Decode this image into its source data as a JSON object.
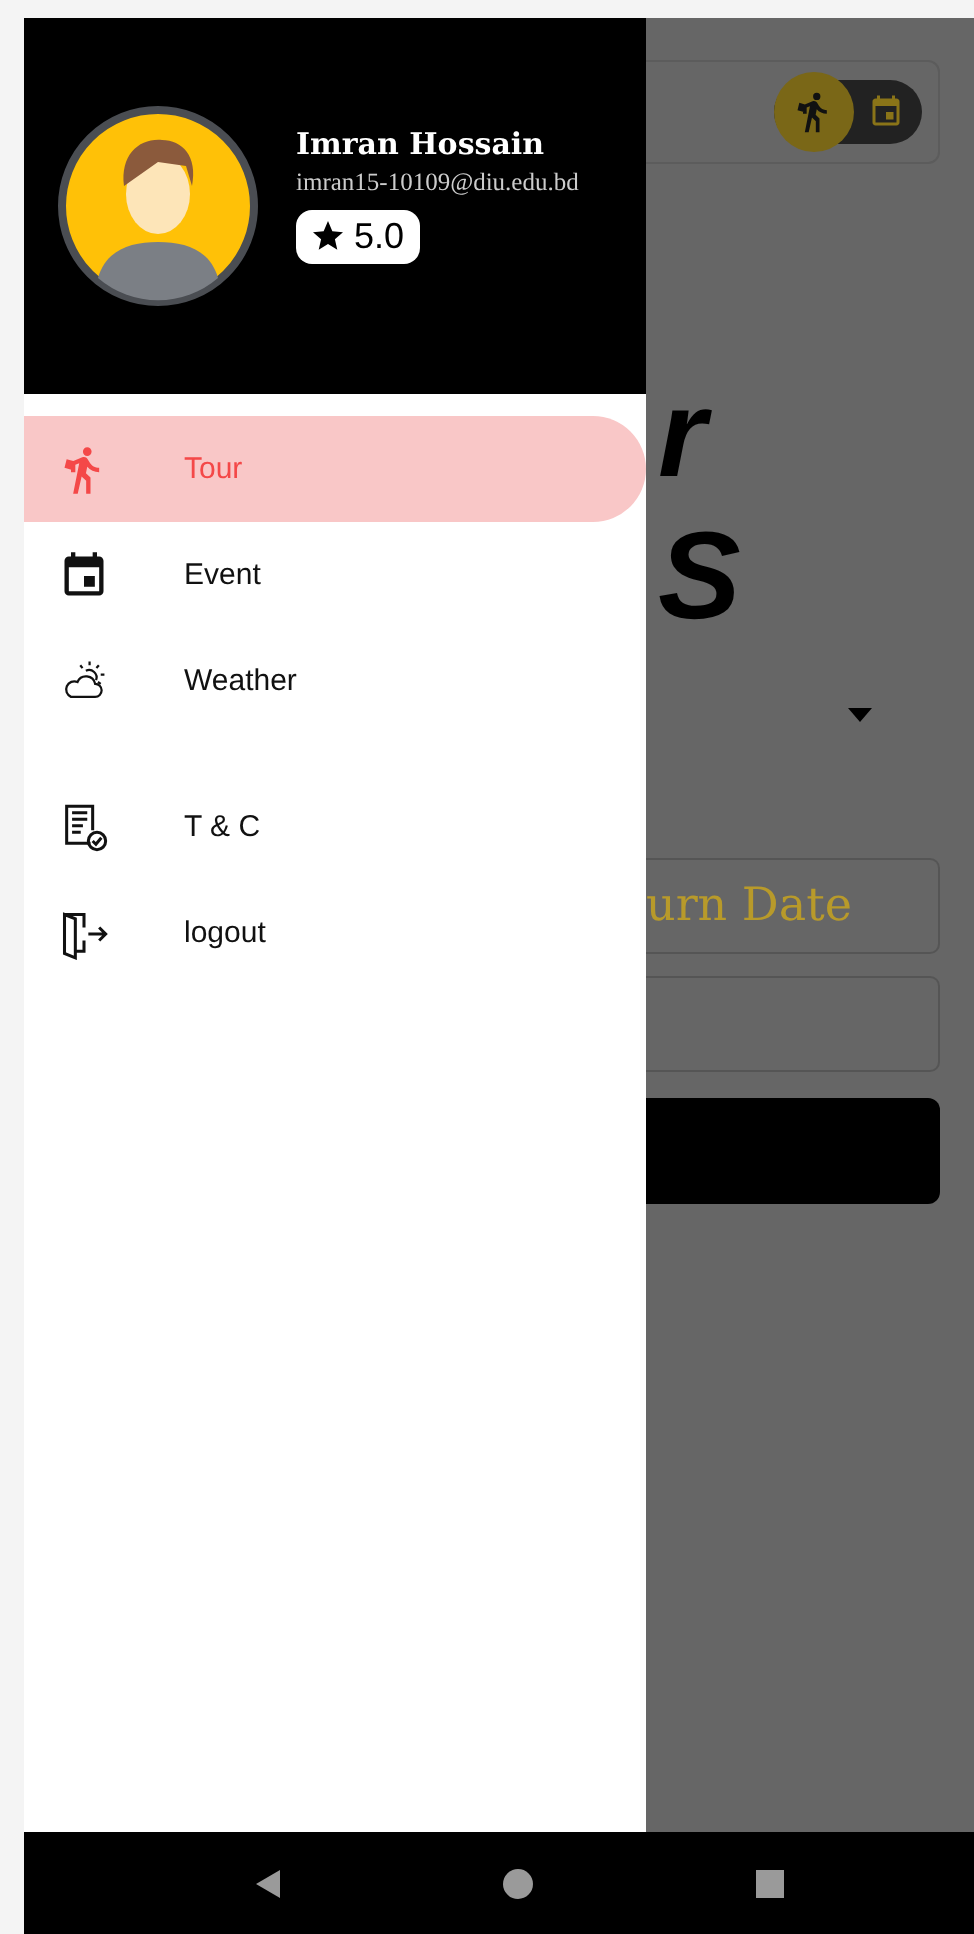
{
  "profile": {
    "name": "Imran Hossain",
    "email": "imran15-10109@diu.edu.bd",
    "rating": "5.0"
  },
  "menu_sections": [
    [
      {
        "label": "Tour",
        "kind": "hiker",
        "selected": true
      },
      {
        "label": "Event",
        "kind": "calendar",
        "selected": false
      },
      {
        "label": "Weather",
        "kind": "weather",
        "selected": false
      }
    ],
    [
      {
        "label": "T & C",
        "kind": "document",
        "selected": false
      },
      {
        "label": "logout",
        "kind": "exit",
        "selected": false
      }
    ]
  ],
  "background": {
    "toggle": [
      {
        "kind": "hiker",
        "selected": true
      },
      {
        "kind": "calendar",
        "selected": false
      }
    ],
    "logo_lines": [
      "r",
      "S"
    ],
    "date_field": "urn Date"
  }
}
